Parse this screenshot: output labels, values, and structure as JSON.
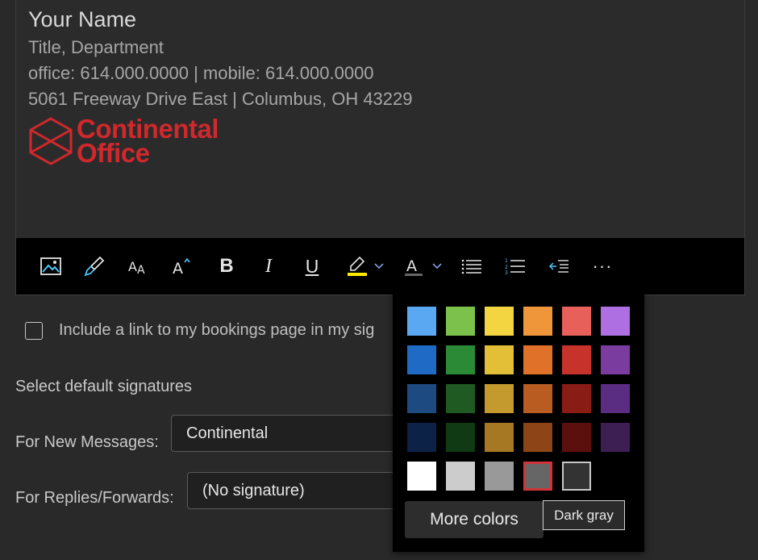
{
  "signature": {
    "name": "Your Name",
    "title": "Title, Department",
    "phones": "office: 614.000.0000 | mobile: 614.000.0000",
    "address": "5061 Freeway Drive East | Columbus, OH 43229",
    "logo_line1": "Continental",
    "logo_line2": "Office",
    "logo_color": "#d0282c"
  },
  "toolbar": {
    "items": [
      "insert-picture-icon",
      "format-painter-icon",
      "font-size-icon",
      "font-size-increase-icon",
      "bold-icon",
      "italic-icon",
      "underline-icon",
      "highlight-icon",
      "font-color-icon",
      "bullets-icon",
      "numbering-icon",
      "decrease-indent-icon",
      "more-options-icon"
    ],
    "bold_glyph": "B",
    "italic_glyph": "I",
    "underline_glyph": "U",
    "more_glyph": "···"
  },
  "bookings": {
    "label": "Include a link to my bookings page in my sig",
    "checked": false
  },
  "defaults": {
    "heading": "Select default signatures",
    "new_label": "For New Messages:",
    "new_value": "Continental",
    "reply_label": "For Replies/Forwards:",
    "reply_value": "(No signature)"
  },
  "palette": {
    "rows": [
      [
        "#5aa8f2",
        "#7cc14b",
        "#f2d540",
        "#f0963a",
        "#e8605a",
        "#ae6fe2"
      ],
      [
        "#1f6ac4",
        "#2a8a35",
        "#e2bf36",
        "#e07128",
        "#c7322b",
        "#7a3d9f"
      ],
      [
        "#1e4a82",
        "#1f5a22",
        "#c49a2e",
        "#b85c22",
        "#8a1c16",
        "#5a2c82"
      ],
      [
        "#0c2247",
        "#0f3a14",
        "#a67823",
        "#8d4518",
        "#5c100d",
        "#3d1f54"
      ],
      [
        "#ffffff",
        "#cccccc",
        "#999999",
        "#666666",
        "#333333"
      ]
    ],
    "selected": "#666666",
    "more_colors": "More colors",
    "tooltip": "Dark gray"
  }
}
